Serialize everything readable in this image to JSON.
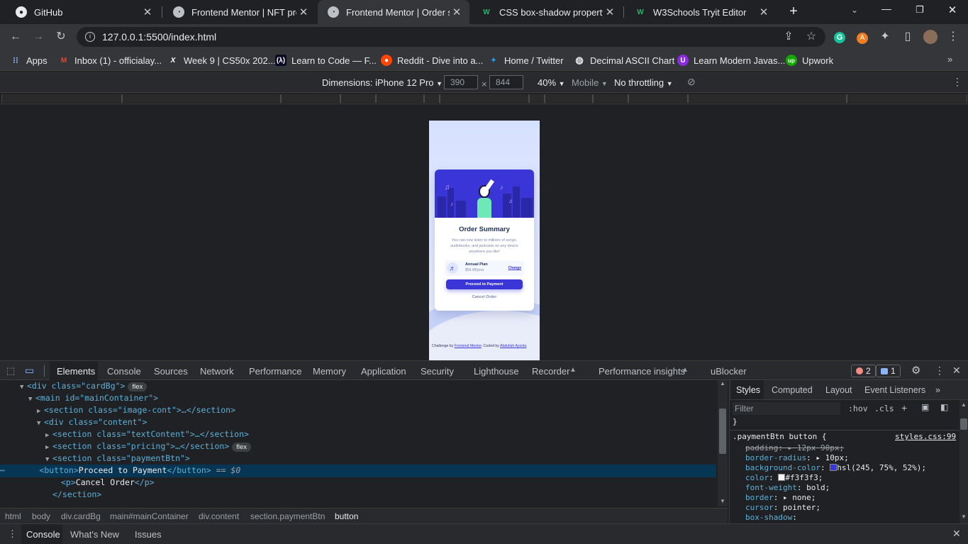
{
  "tabs": [
    {
      "title": "GitHub"
    },
    {
      "title": "Frontend Mentor | NFT previ"
    },
    {
      "title": "Frontend Mentor | Order sum"
    },
    {
      "title": "CSS box-shadow property"
    },
    {
      "title": "W3Schools Tryit Editor"
    }
  ],
  "address": {
    "url": "127.0.0.1:5500/index.html"
  },
  "bookmarks": [
    {
      "label": "Apps"
    },
    {
      "label": "Inbox (1) - officialay..."
    },
    {
      "label": "Week 9 | CS50x 202..."
    },
    {
      "label": "Learn to Code — F..."
    },
    {
      "label": "Reddit - Dive into a..."
    },
    {
      "label": "Home / Twitter"
    },
    {
      "label": "Decimal ASCII Chart"
    },
    {
      "label": "Learn Modern Javas..."
    },
    {
      "label": "Upwork"
    }
  ],
  "device": {
    "dimensions": "Dimensions: iPhone 12 Pro",
    "width": "390",
    "height": "844",
    "zoom": "40%",
    "mode": "Mobile",
    "throttling": "No throttling"
  },
  "card": {
    "title": "Order Summary",
    "desc": "You can now listen to millions of songs, audiobooks, and podcasts on any device anywhere you like!",
    "plan_name": "Annual Plan",
    "plan_price": "$59.99/year",
    "change": "Change",
    "pay": "Proceed to Payment",
    "cancel": "Cancel Order",
    "attr_pre": "Challenge by ",
    "attr_link1": "Frontend Mentor",
    "attr_mid": ". Coded by ",
    "attr_link2": "Abdullah Ayoola",
    "attr_end": "."
  },
  "devtools": {
    "tabs": [
      "Elements",
      "Console",
      "Sources",
      "Network",
      "Performance",
      "Memory",
      "Application",
      "Security",
      "Lighthouse",
      "Recorder",
      "Performance insights",
      "uBlocker"
    ],
    "errors": "2",
    "messages": "1",
    "dom": {
      "l1": "<div class=\"cardBg\">",
      "l2": "<main id=\"mainContainer\">",
      "l3": "<section class=\"image-cont\">…</section>",
      "l4": "<div class=\"content\">",
      "l5": "<section class=\"textContent\">…</section>",
      "l6": "<section class=\"pricing\">…</section>",
      "l7": "<section class=\"paymentBtn\">",
      "l8_text": "Proceed to Payment",
      "l8_eq": " == $0",
      "l9_text": "Cancel Order",
      "l10": "</section>",
      "pill": "flex"
    },
    "breadcrumbs": [
      "html",
      "body",
      "div.cardBg",
      "main#mainContainer",
      "div.content",
      "section.paymentBtn",
      "button"
    ],
    "style_tabs": [
      "Styles",
      "Computed",
      "Layout",
      "Event Listeners"
    ],
    "filter_placeholder": "Filter",
    "hov": ":hov",
    "cls": ".cls",
    "selector": ".paymentBtn button {",
    "source": "styles.css:99",
    "rules": [
      {
        "prop": "padding",
        "value": "12px 90px;"
      },
      {
        "prop": "border-radius",
        "value": "10px;"
      },
      {
        "prop": "background-color",
        "value": "hsl(245, 75%, 52%);"
      },
      {
        "prop": "color",
        "value": "#f3f3f3;"
      },
      {
        "prop": "font-weight",
        "value": "bold;"
      },
      {
        "prop": "border",
        "value": "none;"
      },
      {
        "prop": "cursor",
        "value": "pointer;"
      },
      {
        "prop": "box-shadow",
        "value": ""
      }
    ],
    "drawer_tabs": [
      "Console",
      "What's New",
      "Issues"
    ]
  },
  "colors": {
    "accent": "#3a35d6",
    "selection": "#073655"
  }
}
